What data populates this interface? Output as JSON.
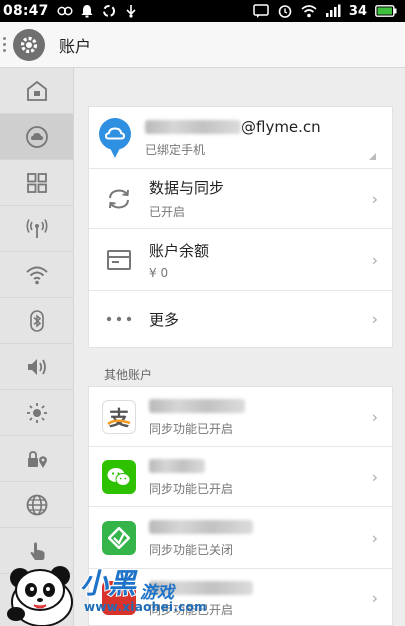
{
  "status_bar": {
    "time": "08:47",
    "battery": "34"
  },
  "header": {
    "title": "账户"
  },
  "sidebar": {
    "items": [
      {
        "icon": "home-icon"
      },
      {
        "icon": "cloud-account-icon"
      },
      {
        "icon": "grid-icon"
      },
      {
        "icon": "hotspot-icon"
      },
      {
        "icon": "wifi-icon"
      },
      {
        "icon": "bluetooth-icon"
      },
      {
        "icon": "volume-icon"
      },
      {
        "icon": "brightness-icon"
      },
      {
        "icon": "location-lock-icon"
      },
      {
        "icon": "globe-icon"
      },
      {
        "icon": "touch-icon"
      }
    ]
  },
  "account_card": {
    "email_suffix": "@flyme.cn",
    "email_sub": "已绑定手机",
    "sync_title": "数据与同步",
    "sync_sub": "已开启",
    "balance_title": "账户余额",
    "balance_value": "¥ 0",
    "more_title": "更多"
  },
  "other_accounts": {
    "label": "其他账户",
    "items": [
      {
        "icon": "alipay-icon",
        "status": "同步功能已开启"
      },
      {
        "icon": "wechat-icon",
        "status": "同步功能已开启"
      },
      {
        "icon": "app-green-icon",
        "status": "同步功能已关闭"
      },
      {
        "icon": "app-red-icon",
        "status": "同步功能已开启"
      }
    ]
  },
  "watermark": {
    "title": "小黑",
    "subtitle": "游戏",
    "url": "www.xiaohei.com"
  },
  "colors": {
    "flyme_blue": "#2f8fe0",
    "wechat_green": "#2dc100",
    "app_green": "#35b44a",
    "alipay_orange": "#f59a23"
  }
}
